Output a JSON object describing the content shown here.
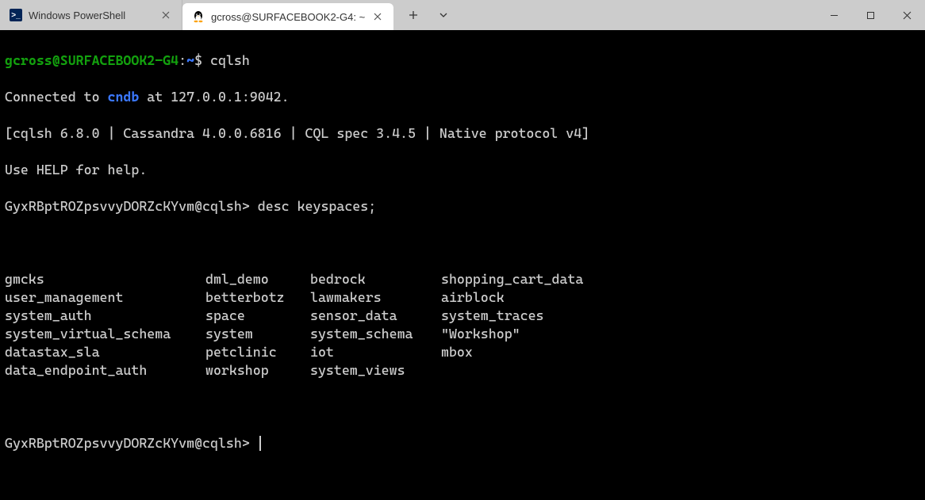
{
  "tabs": [
    {
      "title": "Windows PowerShell",
      "icon": "powershell"
    },
    {
      "title": "gcross@SURFACEBOOK2-G4: ~",
      "icon": "tux"
    }
  ],
  "terminal": {
    "prompt_user_host": "gcross@SURFACEBOOK2-G4",
    "prompt_sep": ":",
    "prompt_path": "~",
    "prompt_dollar": "$",
    "cmd1": "cqlsh",
    "line2_a": "Connected to ",
    "line2_cndb": "cndb",
    "line2_b": " at 127.0.0.1:9042.",
    "line3": "[cqlsh 6.8.0 | Cassandra 4.0.0.6816 | CQL spec 3.4.5 | Native protocol v4]",
    "line4": "Use HELP for help.",
    "prompt2": "GyxRBptROZpsvvyDORZcKYvm@cqlsh>",
    "cmd2": "desc keyspaces;",
    "keyspaces": [
      [
        "gmcks",
        "dml_demo",
        "bedrock",
        "shopping_cart_data"
      ],
      [
        "user_management",
        "betterbotz",
        "lawmakers",
        "airblock"
      ],
      [
        "system_auth",
        "space",
        "sensor_data",
        "system_traces"
      ],
      [
        "system_virtual_schema",
        "system",
        "system_schema",
        "\"Workshop\""
      ],
      [
        "datastax_sla",
        "petclinic",
        "iot",
        "mbox"
      ],
      [
        "data_endpoint_auth",
        "workshop",
        "system_views",
        ""
      ]
    ],
    "prompt3": "GyxRBptROZpsvvyDORZcKYvm@cqlsh>"
  }
}
